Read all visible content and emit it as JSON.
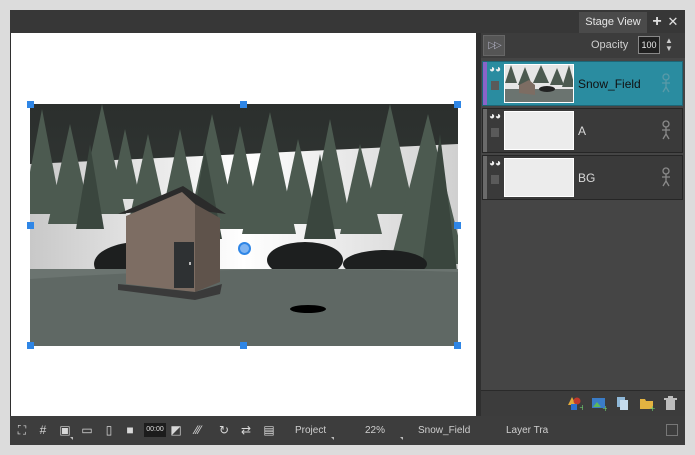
{
  "window": {
    "tab_label": "Stage View"
  },
  "panel": {
    "opacity_label": "Opacity",
    "opacity_value": "100",
    "layers": [
      {
        "name": "Snow_Field",
        "selected": true
      },
      {
        "name": "A",
        "selected": false
      },
      {
        "name": "BG",
        "selected": false
      }
    ]
  },
  "statusbar": {
    "timecode": "00:00",
    "camera": "Project",
    "zoom": "22%",
    "current_layer": "Snow_Field",
    "layer_transform": "Layer Tra"
  },
  "colors": {
    "selected_layer": "#2a8ca0",
    "selection_handles": "#2f86e6",
    "layer_indicator": "#8a63c8"
  }
}
